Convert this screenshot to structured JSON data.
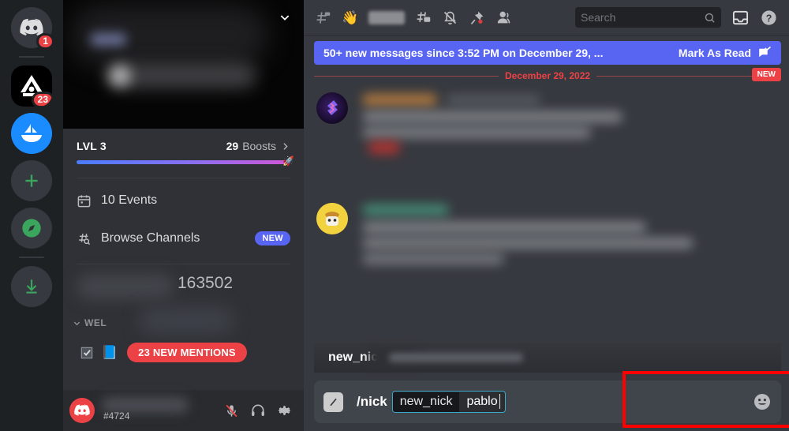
{
  "rail": {
    "servers": [
      {
        "name": "home-discord-button",
        "icon": "discord-logo-icon",
        "badge": "1"
      },
      {
        "name": "server-icon-triangle",
        "icon": "triangle-server-icon",
        "badge": "23"
      },
      {
        "name": "server-icon-boat",
        "icon": "sailboat-server-icon",
        "badge": ""
      },
      {
        "name": "add-server-button",
        "icon": "plus-icon",
        "badge": ""
      },
      {
        "name": "explore-servers-button",
        "icon": "compass-icon",
        "badge": ""
      },
      {
        "name": "download-apps-button",
        "icon": "download-arrow-icon",
        "badge": ""
      }
    ]
  },
  "sidebar": {
    "dropdown_icon": "chevron-down-icon",
    "boost": {
      "level_label": "LVL 3",
      "count": "29",
      "boosts_label": "Boosts",
      "chevron": "chevron-right-icon",
      "progress_percent": 97
    },
    "nav": [
      {
        "icon": "calendar-icon",
        "label": "10 Events",
        "badge": ""
      },
      {
        "icon": "browse-channels-icon",
        "label": "Browse Channels",
        "badge": "NEW"
      }
    ],
    "member_count": "163502",
    "category": {
      "chevron": "chevron-down-icon",
      "label": "WEL"
    },
    "channel": {
      "icon": "checkbox-icon",
      "emoji": "book-emoji",
      "mentions_pill": "23 NEW MENTIONS"
    },
    "user": {
      "avatar_icon": "discord-avatar-icon",
      "tag": "#4724",
      "mic_icon": "mic-muted-icon",
      "headset_icon": "headphones-icon",
      "settings_icon": "gear-icon"
    }
  },
  "topbar": {
    "icons": [
      "locked-channel-hash-icon",
      "wave-emoji-icon",
      "threads-icon",
      "notification-bell-off-icon",
      "pin-icon",
      "members-icon"
    ],
    "search_placeholder": "Search",
    "search_icon": "search-icon",
    "inbox_icon": "inbox-icon",
    "help_icon": "help-circle-icon"
  },
  "chat": {
    "unread_banner": {
      "text": "50+ new messages since 3:52 PM on December 29, ...",
      "action": "Mark As Read",
      "action_icon": "mark-read-icon"
    },
    "date_divider": "December 29, 2022",
    "new_tag": "NEW"
  },
  "command": {
    "suggestion_name": "new_nic",
    "slash_icon": "slash-command-icon",
    "command_name": "/nick",
    "param_key": "new_nick",
    "param_value": "pablo",
    "emoji_icon": "emoji-smiley-icon"
  },
  "colors": {
    "accent_blurple": "#5865f2",
    "danger_red": "#ed4245",
    "highlight_box": "#ff0000",
    "chip_border": "#3ba7c9"
  }
}
